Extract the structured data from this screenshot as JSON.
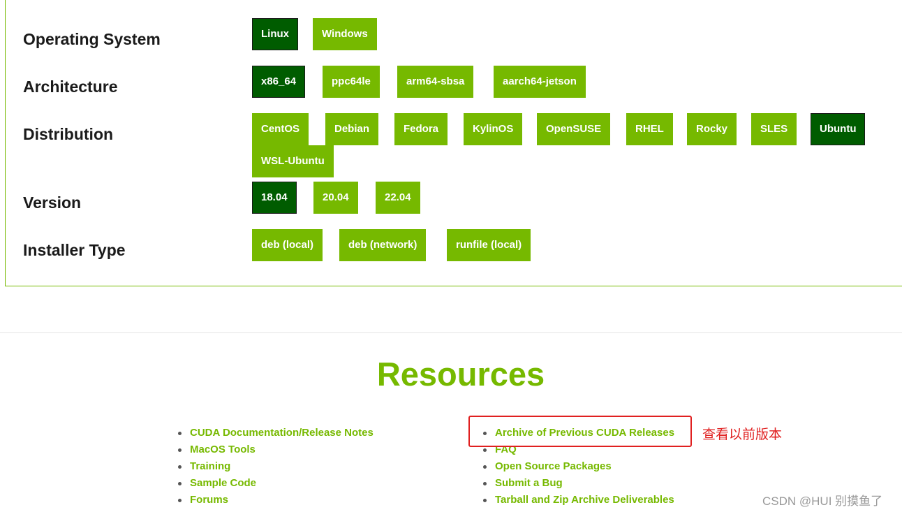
{
  "selector": {
    "os": {
      "label": "Operating System",
      "options": [
        "Linux",
        "Windows"
      ],
      "selected": "Linux"
    },
    "arch": {
      "label": "Architecture",
      "options": [
        "x86_64",
        "ppc64le",
        "arm64-sbsa",
        "aarch64-jetson"
      ],
      "selected": "x86_64"
    },
    "dist": {
      "label": "Distribution",
      "options": [
        "CentOS",
        "Debian",
        "Fedora",
        "KylinOS",
        "OpenSUSE",
        "RHEL",
        "Rocky",
        "SLES",
        "Ubuntu",
        "WSL-Ubuntu"
      ],
      "selected": "Ubuntu"
    },
    "version": {
      "label": "Version",
      "options": [
        "18.04",
        "20.04",
        "22.04"
      ],
      "selected": "18.04"
    },
    "installer": {
      "label": "Installer Type",
      "options": [
        "deb (local)",
        "deb (network)",
        "runfile (local)"
      ],
      "selected": ""
    }
  },
  "resources": {
    "title": "Resources",
    "left_links": [
      "CUDA Documentation/Release Notes",
      "MacOS Tools",
      "Training",
      "Sample Code",
      "Forums"
    ],
    "right_links": [
      "Archive of Previous CUDA Releases",
      "FAQ",
      "Open Source Packages",
      "Submit a Bug",
      "Tarball and Zip Archive Deliverables"
    ]
  },
  "annotation": {
    "text": "查看以前版本"
  },
  "watermark": "CSDN @HUI 别摸鱼了",
  "colors": {
    "accent": "#76b900",
    "selected": "#005c00",
    "annotation": "#e02020"
  }
}
